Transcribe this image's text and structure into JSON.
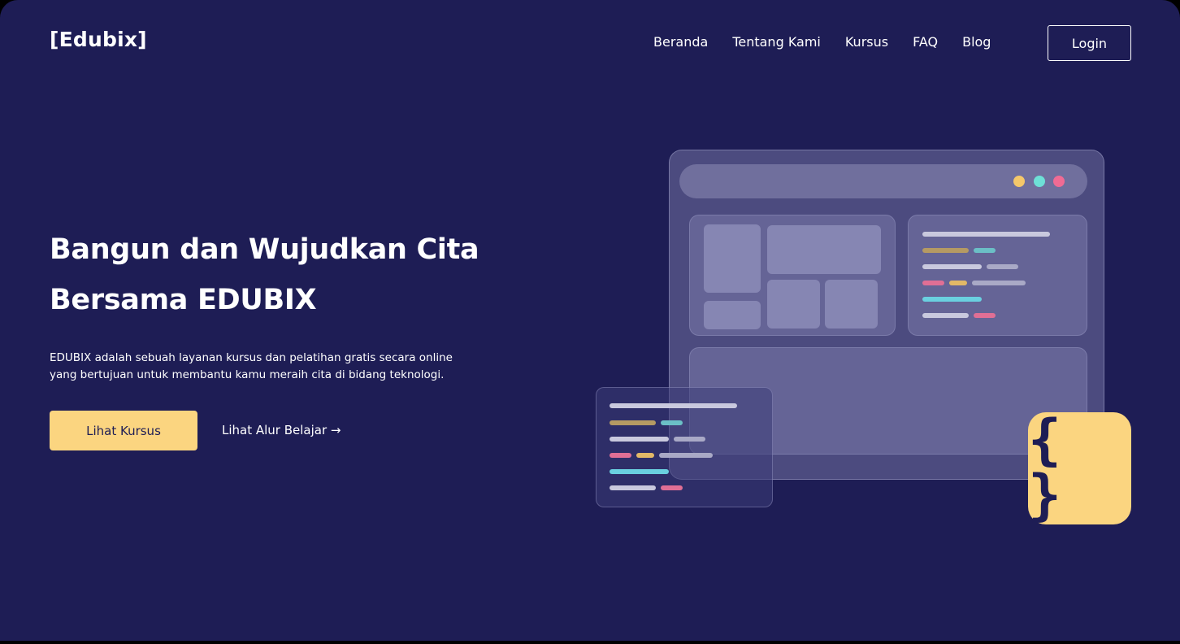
{
  "header": {
    "logo": "[Edubix]",
    "nav": [
      "Beranda",
      "Tentang Kami",
      "Kursus",
      "FAQ",
      "Blog"
    ],
    "login_label": "Login"
  },
  "hero": {
    "title_line1": "Bangun dan Wujudkan Cita",
    "title_line2": "Bersama EDUBIX",
    "description_line1": "EDUBIX adalah sebuah layanan kursus dan pelatihan gratis secara online",
    "description_line2": "yang bertujuan untuk membantu kamu meraih cita di bidang teknologi.",
    "primary_button": "Lihat Kursus",
    "secondary_link": "Lihat Alur Belajar →"
  },
  "illustration": {
    "brace_symbol": "{ }",
    "icons": [
      "browser-window-icon",
      "code-card-icon",
      "curly-braces-icon"
    ]
  },
  "colors": {
    "background": "#1e1d55",
    "accent": "#fbd580",
    "text": "#ffffff",
    "dot_yellow": "#f5c86a",
    "dot_teal": "#6ee0d6",
    "dot_pink": "#f06b94"
  }
}
